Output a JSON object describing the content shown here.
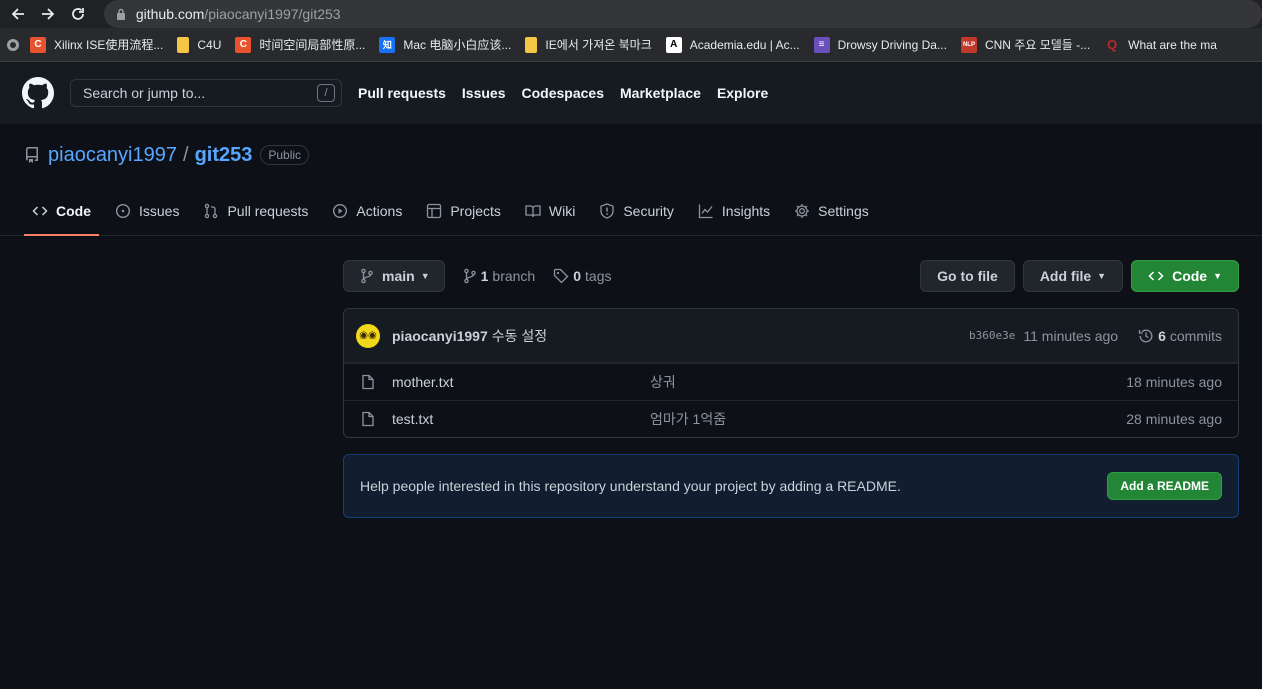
{
  "browser": {
    "url_host": "github.com",
    "url_path": "/piaocanyi1997/git253",
    "bookmarks": [
      {
        "label": "Xilinx ISE使用流程...",
        "icon": "C",
        "color": "#e8532f"
      },
      {
        "label": "C4U",
        "icon": "folder-icon",
        "color": "#f6c744"
      },
      {
        "label": "时间空间局部性原...",
        "icon": "C",
        "color": "#e8532f"
      },
      {
        "label": "Mac 电脑小白应该...",
        "icon": "知",
        "color": "#1772f6"
      },
      {
        "label": "IE에서 가져온 북마크",
        "icon": "folder-icon",
        "color": "#f6c744"
      },
      {
        "label": "Academia.edu | Ac...",
        "icon": "A",
        "color": "#ffffff"
      },
      {
        "label": "Drowsy Driving Da...",
        "icon": "list-icon",
        "color": "#6b4fbb"
      },
      {
        "label": "CNN 주요 모델들 -...",
        "icon": "NLP",
        "color": "#c0392b"
      },
      {
        "label": "What are the ma",
        "icon": "Q",
        "color": "#b92b27"
      }
    ]
  },
  "header": {
    "search_placeholder": "Search or jump to...",
    "slash_key": "/",
    "nav": [
      "Pull requests",
      "Issues",
      "Codespaces",
      "Marketplace",
      "Explore"
    ]
  },
  "repo": {
    "owner": "piaocanyi1997",
    "separator": "/",
    "name": "git253",
    "visibility": "Public"
  },
  "tabs": [
    {
      "label": "Code",
      "icon": "code-icon",
      "active": true
    },
    {
      "label": "Issues",
      "icon": "issue-icon"
    },
    {
      "label": "Pull requests",
      "icon": "pull-request-icon"
    },
    {
      "label": "Actions",
      "icon": "play-icon"
    },
    {
      "label": "Projects",
      "icon": "table-icon"
    },
    {
      "label": "Wiki",
      "icon": "book-icon"
    },
    {
      "label": "Security",
      "icon": "shield-icon"
    },
    {
      "label": "Insights",
      "icon": "graph-icon"
    },
    {
      "label": "Settings",
      "icon": "gear-icon"
    }
  ],
  "toolbar": {
    "branch": "main",
    "branch_count": "1",
    "branch_label": "branch",
    "tag_count": "0",
    "tag_label": "tags",
    "go_to_file": "Go to file",
    "add_file": "Add file",
    "code": "Code"
  },
  "latest_commit": {
    "author": "piaocanyi1997",
    "message": "수동 설정",
    "sha": "b360e3e",
    "age": "11 minutes ago",
    "commit_count": "6",
    "commits_label": "commits"
  },
  "files": [
    {
      "name": "mother.txt",
      "message": "상궈",
      "age": "18 minutes ago"
    },
    {
      "name": "test.txt",
      "message": "엄마가 1억줌",
      "age": "28 minutes ago"
    }
  ],
  "readme": {
    "text": "Help people interested in this repository understand your project by adding a README.",
    "button": "Add a README"
  },
  "colors": {
    "accent_link": "#58a6ff",
    "green_button": "#238636",
    "active_tab_underline": "#f78166"
  }
}
